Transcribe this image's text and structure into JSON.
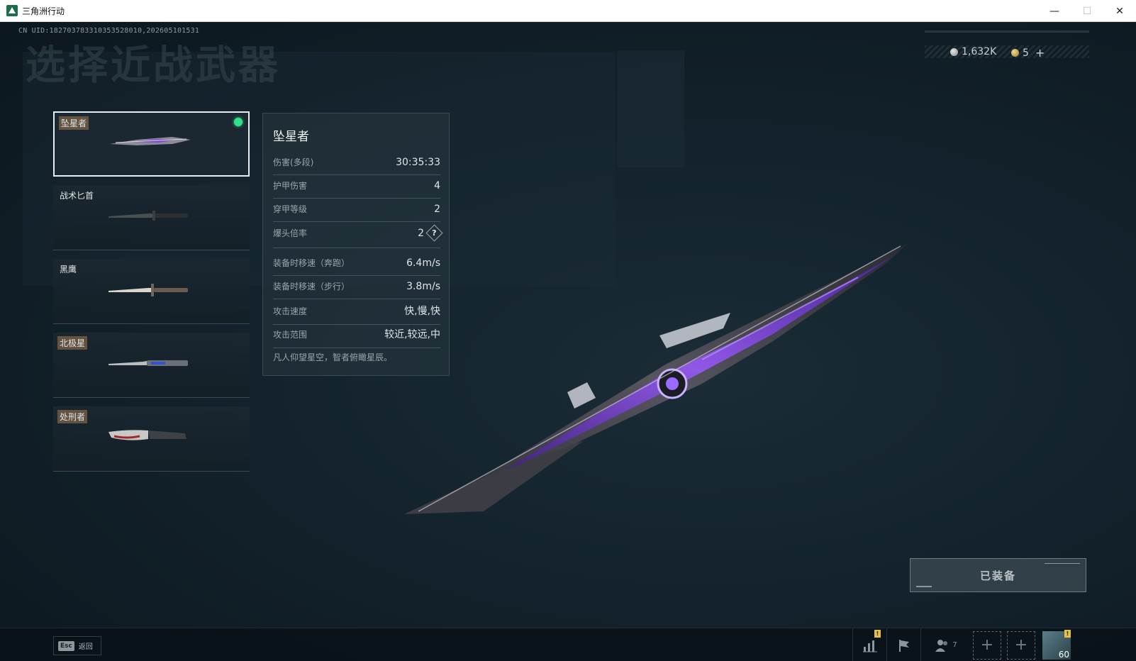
{
  "window": {
    "title": "三角洲行动",
    "minimize": "—",
    "maximize": "☐",
    "close": "✕"
  },
  "header": {
    "uid": "CN UID:182703783310353528010,202605101531",
    "title": "选择近战武器"
  },
  "currencies": [
    {
      "icon": "silver-coin-icon",
      "value": "1,632K"
    },
    {
      "icon": "gold-coin-icon",
      "value": "5",
      "add": "+"
    }
  ],
  "weapons": [
    {
      "name": "坠星者",
      "tagged": true,
      "selected": true,
      "equipped": true
    },
    {
      "name": "战术匕首",
      "tagged": false,
      "selected": false,
      "equipped": false
    },
    {
      "name": "黑鹰",
      "tagged": false,
      "selected": false,
      "equipped": false
    },
    {
      "name": "北极星",
      "tagged": true,
      "selected": false,
      "equipped": false
    },
    {
      "name": "处刑者",
      "tagged": true,
      "selected": false,
      "equipped": false
    }
  ],
  "stats": {
    "title": "坠星者",
    "rows": [
      {
        "label": "伤害(多段)",
        "value": "30:35:33"
      },
      {
        "label": "护甲伤害",
        "value": "4"
      },
      {
        "label": "穿甲等级",
        "value": "2"
      },
      {
        "label": "爆头倍率",
        "value": "2",
        "help": "?"
      },
      {
        "label": "装备时移速（奔跑）",
        "value": "6.4m/s"
      },
      {
        "label": "装备时移速（步行）",
        "value": "3.8m/s"
      },
      {
        "label": "攻击速度",
        "value": "快,慢,快"
      },
      {
        "label": "攻击范围",
        "value": "较近,较远,中"
      }
    ],
    "description": "凡人仰望星空，智者俯瞰星辰。"
  },
  "equip_button": "已装备",
  "bottom": {
    "esc_key": "Esc",
    "back_label": "返回",
    "stats_badge": "!",
    "friend_count": "7",
    "avatar_badge": "!",
    "avatar_level": "60",
    "add": "+"
  },
  "colors": {
    "equipped_dot": "#33e08c",
    "accent_purple": "#8a3cff",
    "badge": "#e3c04a"
  }
}
